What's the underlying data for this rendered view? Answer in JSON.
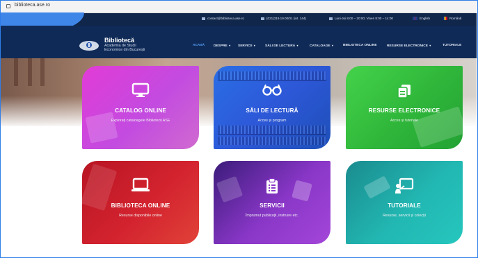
{
  "browser": {
    "url": "biblioteca.ase.ro"
  },
  "topbar": {
    "email": "contact@biblioteca.ase.ro",
    "phone": "(021)319.19.00/01 (int. 144)",
    "hours": "Luni-Joi 8:00 – 20:00; Vineri 8:00 – 14:00",
    "lang_en": "English",
    "lang_ro": "Română"
  },
  "brand": {
    "title": "Bibliotecă",
    "subtitle_line1": "Academia de Studii",
    "subtitle_line2": "Economice din București"
  },
  "nav": {
    "items": [
      {
        "label": "ACASĂ",
        "dropdown": false
      },
      {
        "label": "DESPRE",
        "dropdown": true
      },
      {
        "label": "SERVICII",
        "dropdown": true
      },
      {
        "label": "SĂLI DE LECTURĂ",
        "dropdown": true
      },
      {
        "label": "CATALOAGE",
        "dropdown": true
      },
      {
        "label": "BIBLIOTECA ONLINE",
        "dropdown": false
      },
      {
        "label": "RESURSE ELECTRONICE",
        "dropdown": true
      },
      {
        "label": "TUTORIALE",
        "dropdown": false
      }
    ],
    "caret": "▾"
  },
  "tiles": [
    {
      "title": "CATALOG ONLINE",
      "subtitle": "Explorați cataloagele Bibliotecii ASE",
      "icon": "monitor-icon",
      "color": "#d93edc"
    },
    {
      "title": "SĂLI DE LECTURĂ",
      "subtitle": "Acces și program",
      "icon": "glasses-icon",
      "color": "#2b66e0"
    },
    {
      "title": "RESURSE ELECTRONICE",
      "subtitle": "Acces și tutoriale",
      "icon": "copy-icon",
      "color": "#33bf3c"
    },
    {
      "title": "BIBLIOTECA ONLINE",
      "subtitle": "Resurse disponibile online",
      "icon": "laptop-icon",
      "color": "#cc1f2c"
    },
    {
      "title": "SERVICII",
      "subtitle": "Împrumut publicații, instruire etc.",
      "icon": "clipboard-icon",
      "color": "#8d3ac9"
    },
    {
      "title": "TUTORIALE",
      "subtitle": "Resurse, servicii și colecții",
      "icon": "presentation-icon",
      "color": "#22b5b0"
    }
  ]
}
